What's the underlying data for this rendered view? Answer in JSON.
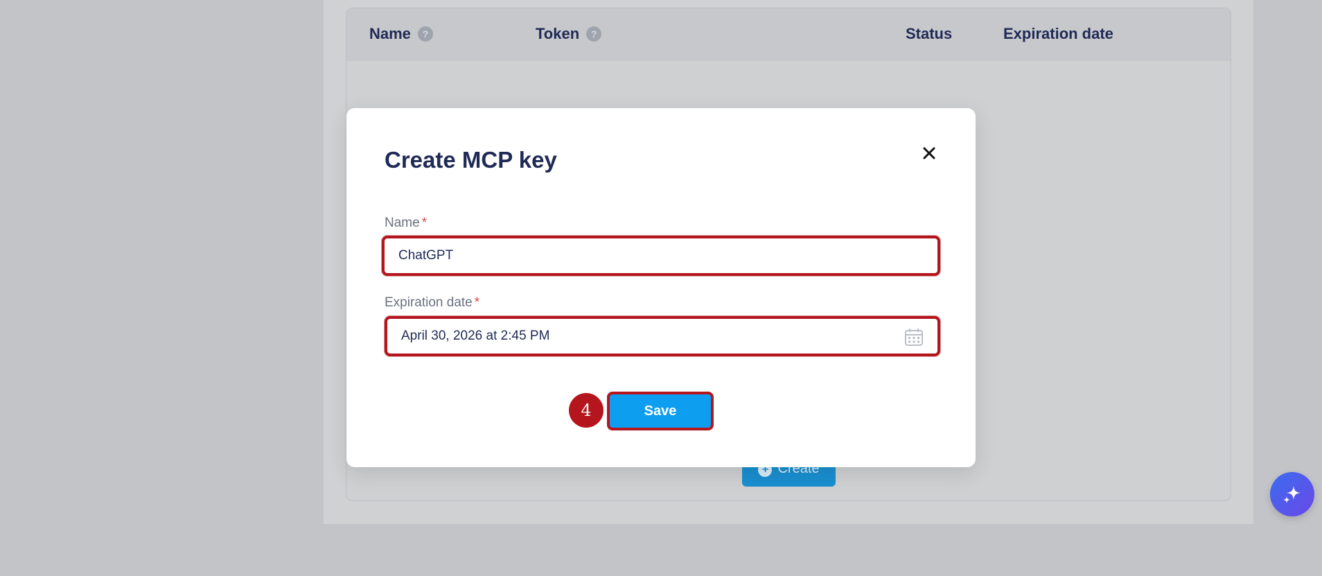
{
  "table": {
    "columns": [
      {
        "label": "Name",
        "help": "?"
      },
      {
        "label": "Token",
        "help": "?"
      },
      {
        "label": "Status"
      },
      {
        "label": "Expiration date"
      }
    ],
    "create_label": "Create"
  },
  "modal": {
    "title": "Create MCP key",
    "close_icon": "close-icon",
    "name_field": {
      "label": "Name",
      "required_mark": "*",
      "value": "ChatGPT"
    },
    "expiration_field": {
      "label": "Expiration date",
      "required_mark": "*",
      "value": "April 30, 2026 at 2:45 PM",
      "icon": "calendar-icon"
    },
    "step_badge": "4",
    "save_label": "Save"
  },
  "colors": {
    "accent": "#0e9ef0",
    "highlight": "#b5161d",
    "title": "#1f2a55"
  },
  "fab": {
    "icon": "sparkle-icon"
  }
}
